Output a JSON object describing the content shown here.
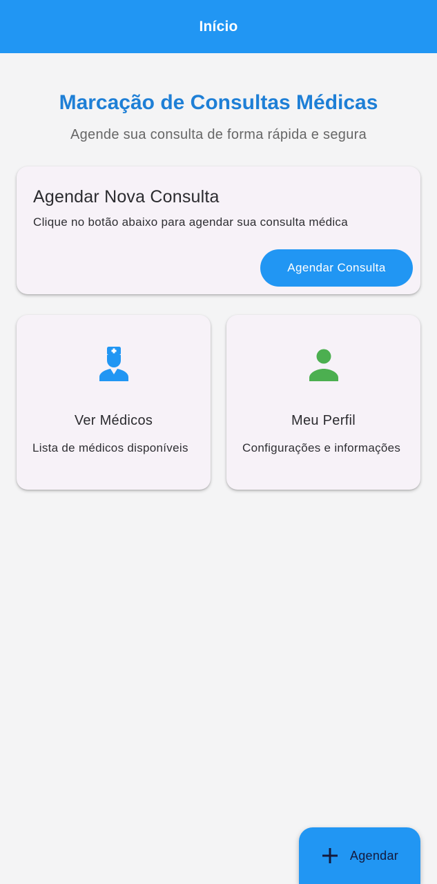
{
  "appbar": {
    "title": "Início"
  },
  "hero": {
    "title": "Marcação de Consultas Médicas",
    "subtitle": "Agende sua consulta de forma rápida e segura"
  },
  "schedule_card": {
    "title": "Agendar Nova Consulta",
    "description": "Clique no botão abaixo para agendar sua consulta médica",
    "button_label": "Agendar Consulta"
  },
  "cards": [
    {
      "title": "Ver Médicos",
      "description": "Lista de médicos disponíveis",
      "icon": "doctor-icon",
      "icon_color": "#2196f3"
    },
    {
      "title": "Meu Perfil",
      "description": "Configurações e informações",
      "icon": "person-icon",
      "icon_color": "#4caf50"
    }
  ],
  "fab": {
    "label": "Agendar",
    "icon": "plus-icon"
  },
  "colors": {
    "primary": "#2196f3",
    "title_blue": "#1e7fd6",
    "success_green": "#4caf50",
    "background": "#f4f4f5",
    "card_background": "#f7f2f8"
  }
}
